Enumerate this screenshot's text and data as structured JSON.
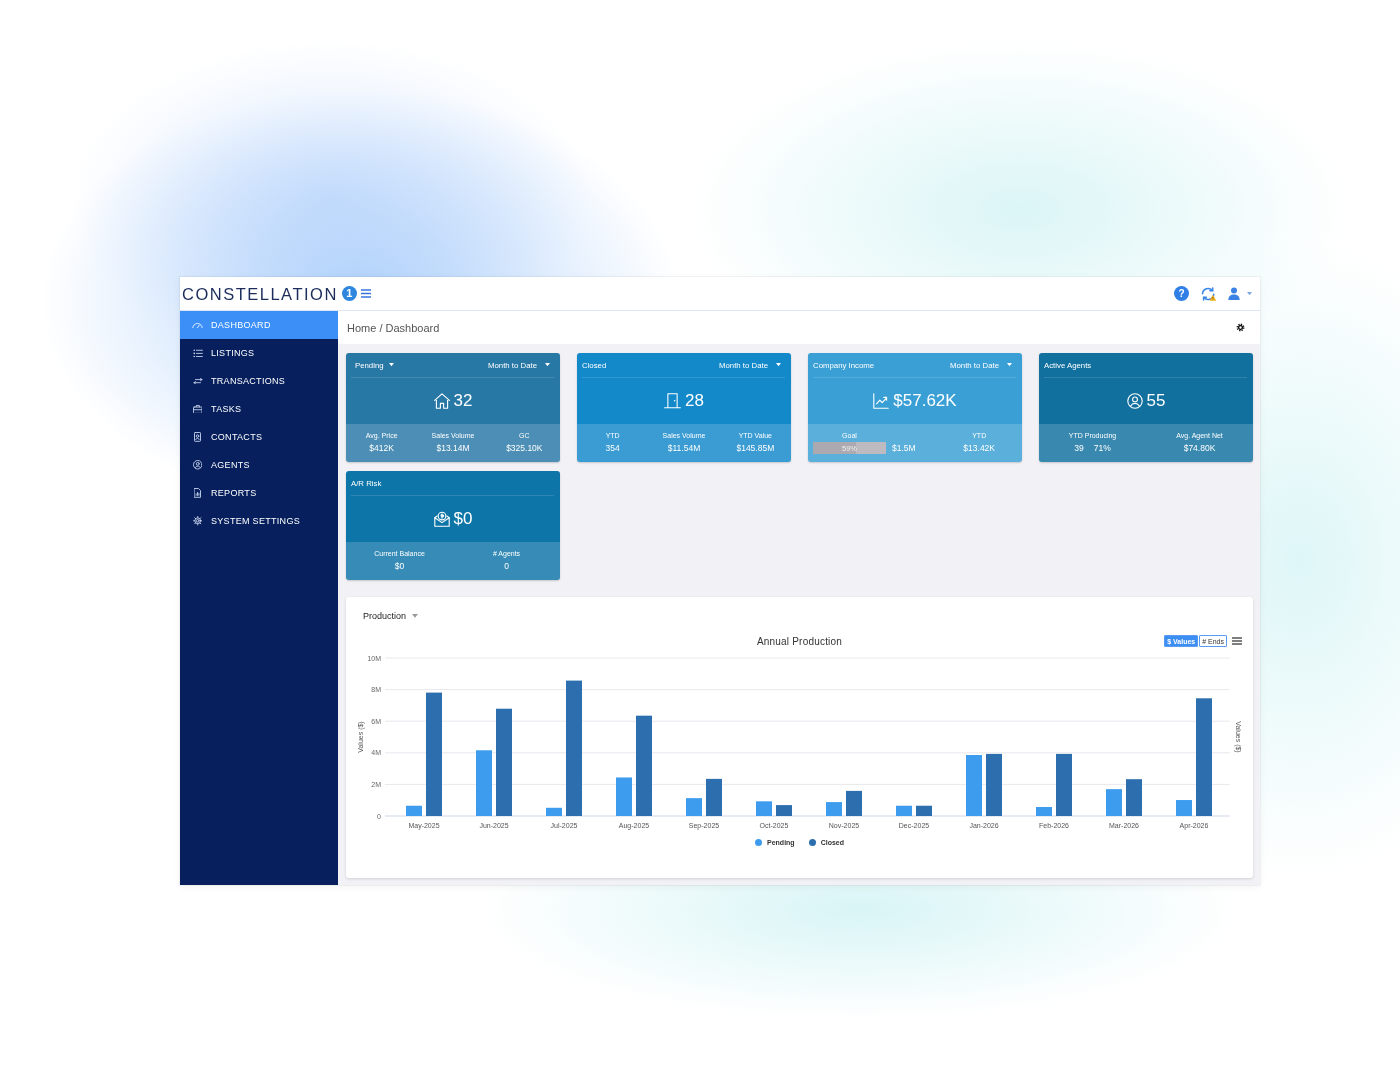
{
  "header": {
    "logo": {
      "text": "CONSTELLATION",
      "badge": "1"
    },
    "help": "?"
  },
  "sidebar": {
    "items": [
      {
        "label": "DASHBOARD",
        "selected": true
      },
      {
        "label": "LISTINGS",
        "selected": false
      },
      {
        "label": "TRANSACTIONS",
        "selected": false
      },
      {
        "label": "TASKS",
        "selected": false
      },
      {
        "label": "CONTACTS",
        "selected": false
      },
      {
        "label": "AGENTS",
        "selected": false
      },
      {
        "label": "REPORTS",
        "selected": false
      },
      {
        "label": "SYSTEM SETTINGS",
        "selected": false
      }
    ]
  },
  "breadcrumb": "Home / Dashboard",
  "cards": [
    {
      "title": "Pending",
      "title_dropdown": true,
      "period": "Month to Date",
      "value": "32",
      "color": "#2878a6",
      "stats": [
        {
          "kind": "plain",
          "label": "Avg. Price",
          "values": [
            "$412K"
          ]
        },
        {
          "kind": "plain",
          "label": "Sales Volume",
          "values": [
            "$13.14M"
          ]
        },
        {
          "kind": "plain",
          "label": "GC",
          "values": [
            "$325.10K"
          ]
        }
      ]
    },
    {
      "title": "Closed",
      "title_dropdown": false,
      "period": "Month to Date",
      "value": "28",
      "color": "#1489ca",
      "stats": [
        {
          "kind": "plain",
          "label": "YTD",
          "values": [
            "354"
          ]
        },
        {
          "kind": "plain",
          "label": "Sales Volume",
          "values": [
            "$11.54M"
          ]
        },
        {
          "kind": "plain",
          "label": "YTD Value",
          "values": [
            "$145.85M"
          ]
        }
      ]
    },
    {
      "title": "Company Income",
      "title_dropdown": false,
      "period": "Month to Date",
      "value": "$57.62K",
      "color": "#3a9fd4",
      "stats": [
        {
          "kind": "goal",
          "label": "Goal",
          "level": 0.59,
          "reading": "59%",
          "values": [
            "$1.5M"
          ]
        },
        {
          "kind": "plain",
          "label": "YTD",
          "values": [
            "$13.42K"
          ]
        }
      ]
    },
    {
      "title": "Active Agents",
      "title_dropdown": false,
      "value": "55",
      "color": "#12709f",
      "stats": [
        {
          "kind": "plain",
          "label": "YTD Producing",
          "values": [
            "39",
            "71%"
          ]
        },
        {
          "kind": "plain",
          "label": "Avg. Agent Net",
          "values": [
            "$74.80K"
          ]
        }
      ]
    },
    {
      "title": "A/R Risk",
      "title_dropdown": false,
      "value": "$0",
      "color": "#0e75a8",
      "stats": [
        {
          "kind": "plain",
          "label": "Current Balance",
          "values": [
            "$0"
          ]
        },
        {
          "kind": "plain",
          "label": "# Agents",
          "values": [
            "0"
          ]
        }
      ]
    }
  ],
  "production": {
    "title": "Production",
    "toggles": [
      {
        "label": "$ Values",
        "selected": true
      },
      {
        "label": "# Ends",
        "selected": false
      }
    ],
    "right_axis_label": "Values ($)",
    "chart_data": {
      "type": "bar",
      "title": "Annual Production",
      "ylabel": "Values ($)",
      "grid": true,
      "legend": true,
      "categories": [
        "May-2025",
        "Jun-2025",
        "Jul-2025",
        "Aug-2025",
        "Sep-2025",
        "Oct-2025",
        "Nov-2025",
        "Dec-2025",
        "Jan-2026",
        "Feb-2026",
        "Mar-2026",
        "Apr-2026"
      ],
      "series": [
        {
          "name": "Pending",
          "color": "#3e9cef",
          "values": [
            650000,
            4160000,
            520000,
            2440000,
            1130000,
            930000,
            880000,
            650000,
            3860000,
            570000,
            1700000,
            1010000
          ]
        },
        {
          "name": "Closed",
          "color": "#2d6fae",
          "values": [
            7810000,
            6790000,
            8570000,
            6350000,
            2350000,
            690000,
            1590000,
            650000,
            3930000,
            3930000,
            2330000,
            7450000
          ]
        }
      ],
      "ylim": [
        0,
        10000000
      ],
      "yticks": [
        {
          "value": 0,
          "label": "0"
        },
        {
          "value": 2000000,
          "label": "2M"
        },
        {
          "value": 4000000,
          "label": "4M"
        },
        {
          "value": 6000000,
          "label": "6M"
        },
        {
          "value": 8000000,
          "label": "8M"
        },
        {
          "value": 10000000,
          "label": "10M"
        }
      ]
    }
  }
}
